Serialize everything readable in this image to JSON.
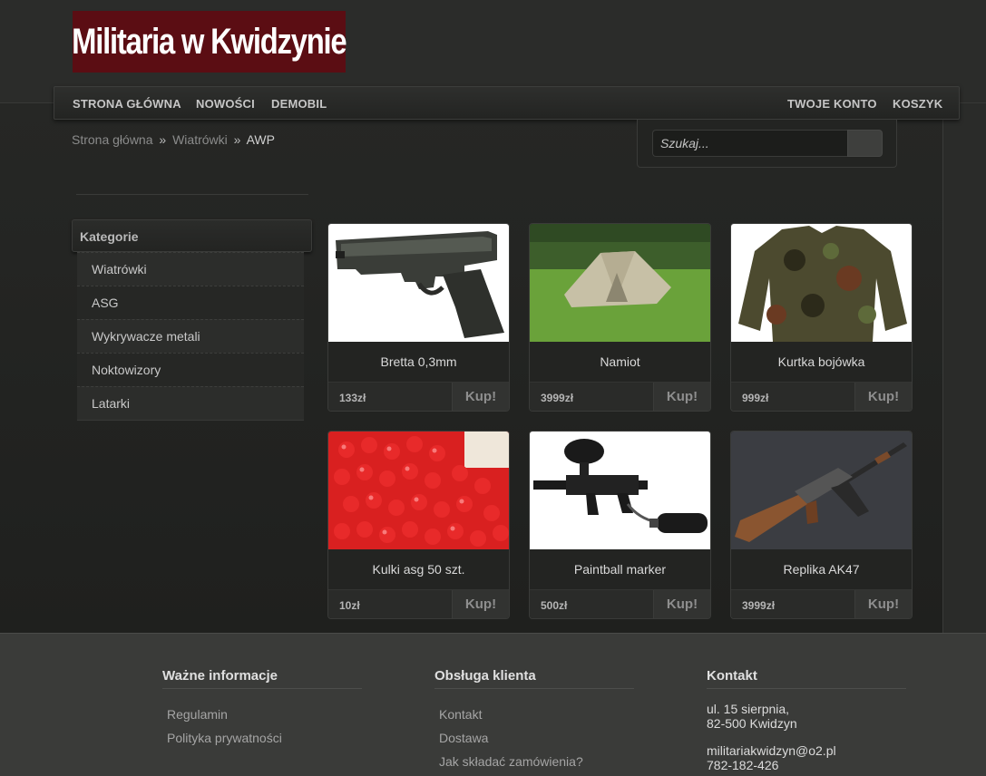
{
  "logo": {
    "text": "Militaria w Kwidzynie"
  },
  "nav": {
    "left": [
      "STRONA GŁÓWNA",
      "NOWOŚCI",
      "DEMOBIL"
    ],
    "right": [
      "TWOJE KONTO",
      "KOSZYK"
    ]
  },
  "breadcrumb": {
    "items": [
      "Strona główna",
      "Wiatrówki"
    ],
    "separator": "»",
    "current": "AWP"
  },
  "search": {
    "placeholder": "Szukaj..."
  },
  "sidebar": {
    "title": "Kategorie",
    "items": [
      "Wiatrówki",
      "ASG",
      "Wykrywacze metali",
      "Noktowizory",
      "Latarki"
    ]
  },
  "products": [
    {
      "name": "Bretta 0,3mm",
      "price": "133zł",
      "buy": "Kup!",
      "icon": "pistol-image"
    },
    {
      "name": "Namiot",
      "price": "3999zł",
      "buy": "Kup!",
      "icon": "tent-image"
    },
    {
      "name": "Kurtka bojówka",
      "price": "999zł",
      "buy": "Kup!",
      "icon": "camo-jacket-image"
    },
    {
      "name": "Kulki asg 50 szt.",
      "price": "10zł",
      "buy": "Kup!",
      "icon": "red-pellets-image"
    },
    {
      "name": "Paintball marker",
      "price": "500zł",
      "buy": "Kup!",
      "icon": "paintball-marker-image"
    },
    {
      "name": "Replika AK47",
      "price": "3999zł",
      "buy": "Kup!",
      "icon": "rifle-image"
    }
  ],
  "footer": {
    "info": {
      "title": "Ważne informacje",
      "links": [
        "Regulamin",
        "Polityka prywatności"
      ]
    },
    "service": {
      "title": "Obsługa klienta",
      "links": [
        "Kontakt",
        "Dostawa",
        "Jak składać zamówienia?"
      ]
    },
    "contact": {
      "title": "Kontakt",
      "address1": "ul. 15 sierpnia,",
      "address2": "82-500 Kwidzyn",
      "email": "militariakwidzyn@o2.pl",
      "phone": "782-182-426"
    }
  }
}
